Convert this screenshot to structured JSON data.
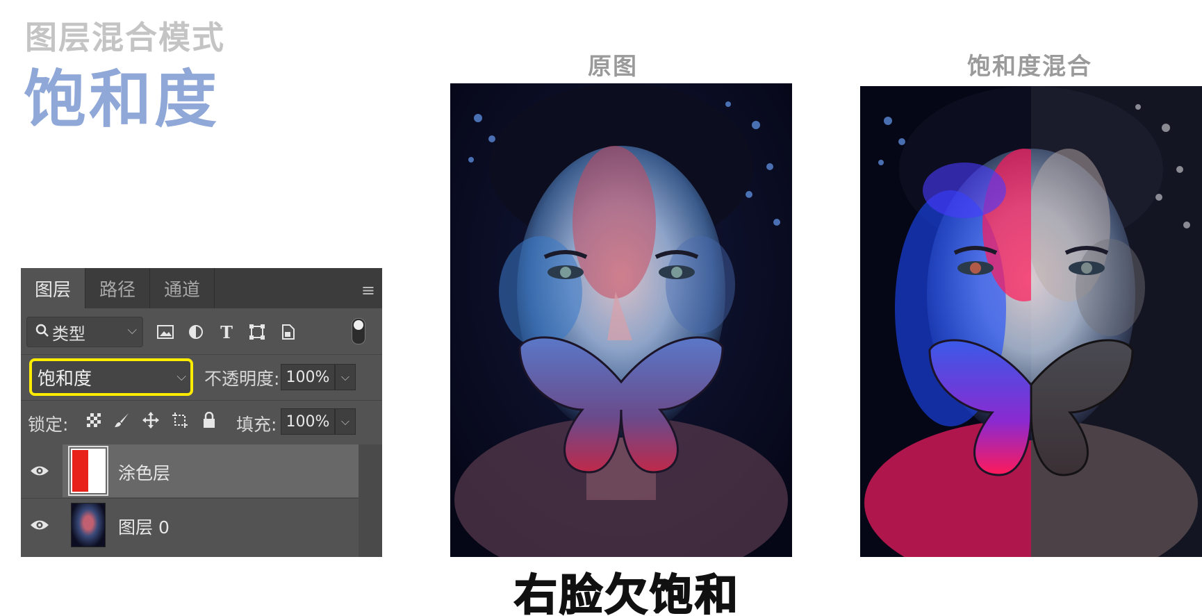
{
  "header": {
    "subtitle": "图层混合模式",
    "title": "饱和度"
  },
  "captions": {
    "original": "原图",
    "blend": "饱和度混合"
  },
  "subtitle_text": "右脸欠饱和",
  "layers_panel": {
    "tabs": [
      {
        "label": "图层",
        "active": true
      },
      {
        "label": "路径",
        "active": false
      },
      {
        "label": "通道",
        "active": false
      }
    ],
    "filter": {
      "label": "类型",
      "icons": [
        "image-filter-icon",
        "adjustment-filter-icon",
        "type-filter-icon",
        "shape-filter-icon",
        "smart-object-filter-icon"
      ]
    },
    "blend_mode": "饱和度",
    "opacity_label": "不透明度:",
    "opacity_value": "100%",
    "lock_label": "锁定:",
    "fill_label": "填充:",
    "fill_value": "100%",
    "layers": [
      {
        "name": "涂色层",
        "visible": true,
        "selected": true
      },
      {
        "name": "图层 0",
        "visible": true,
        "selected": false
      }
    ]
  },
  "colors": {
    "title_blue": "#8fa8d8",
    "highlight_yellow": "#ffec00",
    "panel_bg": "#535353"
  }
}
